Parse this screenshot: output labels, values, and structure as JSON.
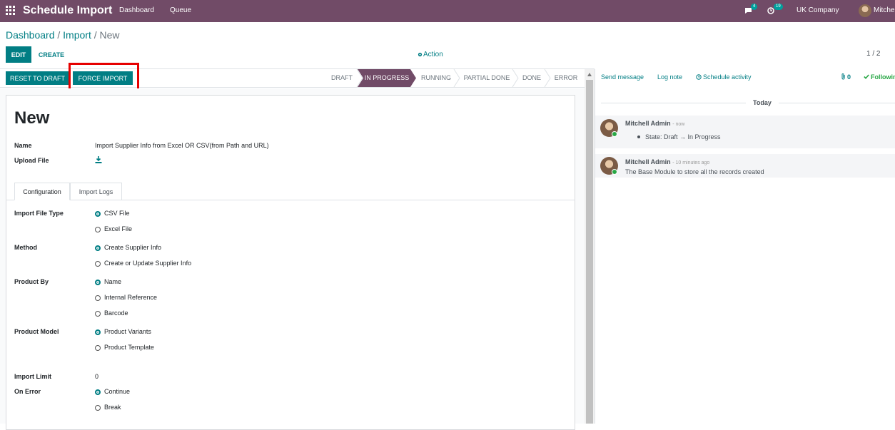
{
  "app": {
    "title": "Schedule Import",
    "menu": [
      "Dashboard",
      "Queue"
    ]
  },
  "systray": {
    "messages_count": "4",
    "activities_count": "19",
    "company": "UK Company",
    "user": "Mitchell Admin"
  },
  "breadcrumb": {
    "root": "Dashboard",
    "middle": "Import",
    "current": "New",
    "separator": "/"
  },
  "controls": {
    "edit": "EDIT",
    "create": "CREATE",
    "action": "Action",
    "pager": "1 / 2"
  },
  "statusbar": {
    "reset": "RESET TO DRAFT",
    "force": "FORCE IMPORT",
    "stages": [
      "DRAFT",
      "IN PROGRESS",
      "RUNNING",
      "PARTIAL DONE",
      "DONE",
      "ERROR"
    ],
    "active_stage": "IN PROGRESS"
  },
  "form": {
    "title": "New",
    "name_label": "Name",
    "name_value": "Import Supplier Info from Excel OR CSV(from Path and URL)",
    "upload_label": "Upload File",
    "tabs": [
      "Configuration",
      "Import Logs"
    ],
    "file_type_label": "Import File Type",
    "file_type_options": [
      "CSV File",
      "Excel File"
    ],
    "method_label": "Method",
    "method_options": [
      "Create Supplier Info",
      "Create or Update Supplier Info"
    ],
    "product_by_label": "Product By",
    "product_by_options": [
      "Name",
      "Internal Reference",
      "Barcode"
    ],
    "product_model_label": "Product Model",
    "product_model_options": [
      "Product Variants",
      "Product Template"
    ],
    "import_limit_label": "Import Limit",
    "import_limit_value": "0",
    "on_error_label": "On Error",
    "on_error_options": [
      "Continue",
      "Break"
    ]
  },
  "chatter": {
    "send_message": "Send message",
    "log_note": "Log note",
    "schedule_activity": "Schedule activity",
    "attachments": "0",
    "following": "Following",
    "today": "Today",
    "messages": [
      {
        "author": "Mitchell Admin",
        "time": "- now",
        "text": "State: Draft → In Progress"
      },
      {
        "author": "Mitchell Admin",
        "time": "- 10 minutes ago",
        "text": "The Base Module to store all the records created"
      }
    ]
  },
  "colors": {
    "brand": "#714b67",
    "primary": "#017e84",
    "highlight": "#e60000",
    "online": "#28a745"
  }
}
